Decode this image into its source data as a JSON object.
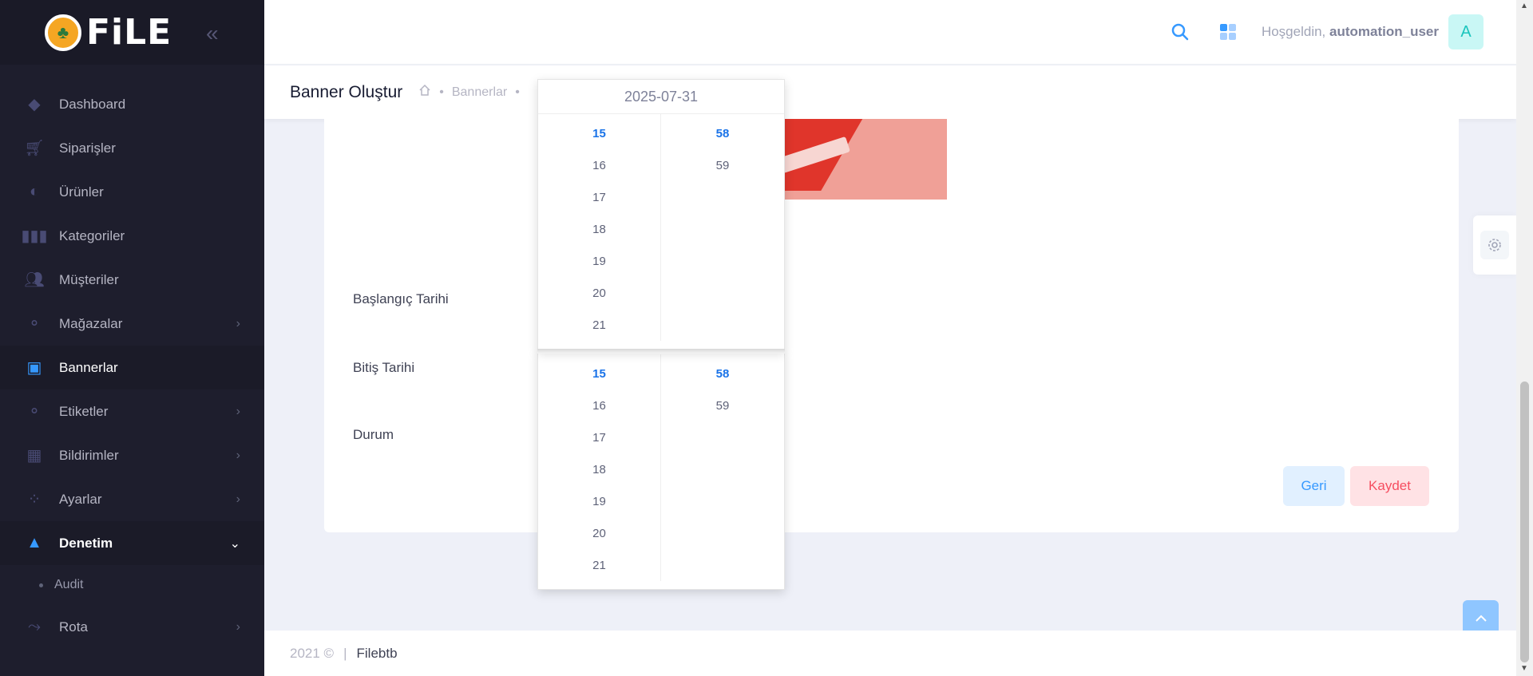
{
  "brand": {
    "logo_text": "FiLE"
  },
  "sidebar": {
    "items": [
      {
        "label": "Dashboard",
        "icon": "diamond-icon"
      },
      {
        "label": "Siparişler",
        "icon": "cart-icon"
      },
      {
        "label": "Ürünler",
        "icon": "moon-icon"
      },
      {
        "label": "Kategoriler",
        "icon": "barcode-icon"
      },
      {
        "label": "Müşteriler",
        "icon": "users-icon"
      },
      {
        "label": "Mağazalar",
        "icon": "store-icon"
      },
      {
        "label": "Bannerlar",
        "icon": "image-icon"
      },
      {
        "label": "Etiketler",
        "icon": "tag-icon"
      },
      {
        "label": "Bildirimler",
        "icon": "grid-icon"
      },
      {
        "label": "Ayarlar",
        "icon": "settings-icon"
      },
      {
        "label": "Denetim",
        "icon": "cone-icon"
      },
      {
        "label": "Audit",
        "icon": "dot-icon"
      },
      {
        "label": "Rota",
        "icon": "route-icon"
      }
    ]
  },
  "header": {
    "greeting": "Hoşgeldin,",
    "username": "automation_user",
    "avatar_letter": "A"
  },
  "subheader": {
    "title": "Banner Oluştur",
    "breadcrumb": [
      "Bannerlar"
    ]
  },
  "form": {
    "start_label": "Başlangıç Tarihi",
    "end_label": "Bitiş Tarihi",
    "status_label": "Durum",
    "back_button": "Geri",
    "save_button": "Kaydet"
  },
  "picker_top": {
    "date": "2025-07-31",
    "hours": [
      "15",
      "16",
      "17",
      "18",
      "19",
      "20",
      "21"
    ],
    "minutes": [
      "58",
      "59"
    ]
  },
  "picker_bottom": {
    "hours": [
      "15",
      "16",
      "17",
      "18",
      "19",
      "20",
      "21"
    ],
    "minutes": [
      "58",
      "59"
    ]
  },
  "footer": {
    "year": "2021 ©",
    "separator": "|",
    "company": "Filebtb"
  },
  "colors": {
    "accent": "#3699ff",
    "sidebar_bg": "#1e1e2d",
    "danger_light": "#ffe2e5"
  }
}
